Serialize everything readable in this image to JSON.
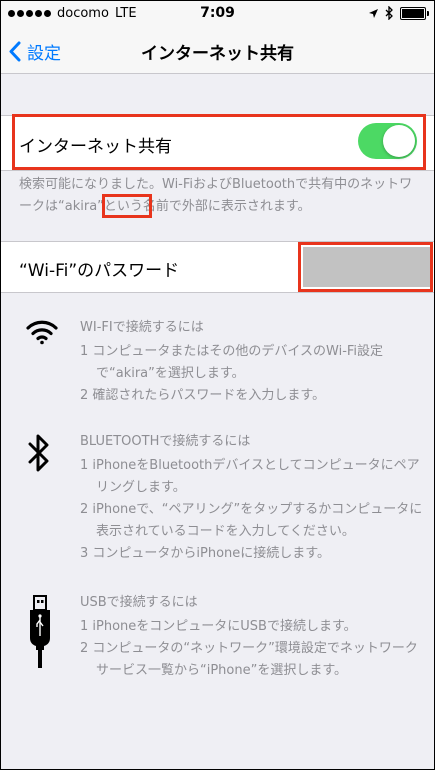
{
  "status_bar": {
    "carrier": "docomo",
    "network": "LTE",
    "time": "7:09"
  },
  "nav": {
    "back_label": "設定",
    "title": "インターネット共有"
  },
  "hotspot": {
    "label": "インターネット共有",
    "enabled": true,
    "footer_pre": "検索可能になりました。Wi-FiおよびBluetoothで共有中のネットワークは",
    "footer_name": "“akira”",
    "footer_post": "という名前で外部に表示されます。"
  },
  "wifi_password": {
    "label": "“Wi-Fi”のパスワード"
  },
  "instructions": {
    "wifi": {
      "heading": "WI-FIで接続するには",
      "steps": [
        "1 コンピュータまたはその他のデバイスのWi-Fi設定で“akira”を選択します。",
        "2 確認されたらパスワードを入力します。"
      ]
    },
    "bluetooth": {
      "heading": "BLUETOOTHで接続するには",
      "steps": [
        "1 iPhoneをBluetoothデバイスとしてコンピュータにペアリングします。",
        "2 iPhoneで、“ペアリング”をタップするかコンピュータに表示されているコードを入力してください。",
        "3 コンピュータからiPhoneに接続します。"
      ]
    },
    "usb": {
      "heading": "USBで接続するには",
      "steps": [
        "1 iPhoneをコンピュータにUSBで接続します。",
        "2 コンピュータの“ネットワーク”環境設定でネットワークサービス一覧から“iPhone”を選択します。"
      ]
    }
  },
  "colors": {
    "accent": "#007aff",
    "switch_on": "#4cd964",
    "highlight": "#e8341c",
    "background": "#efeff4"
  }
}
